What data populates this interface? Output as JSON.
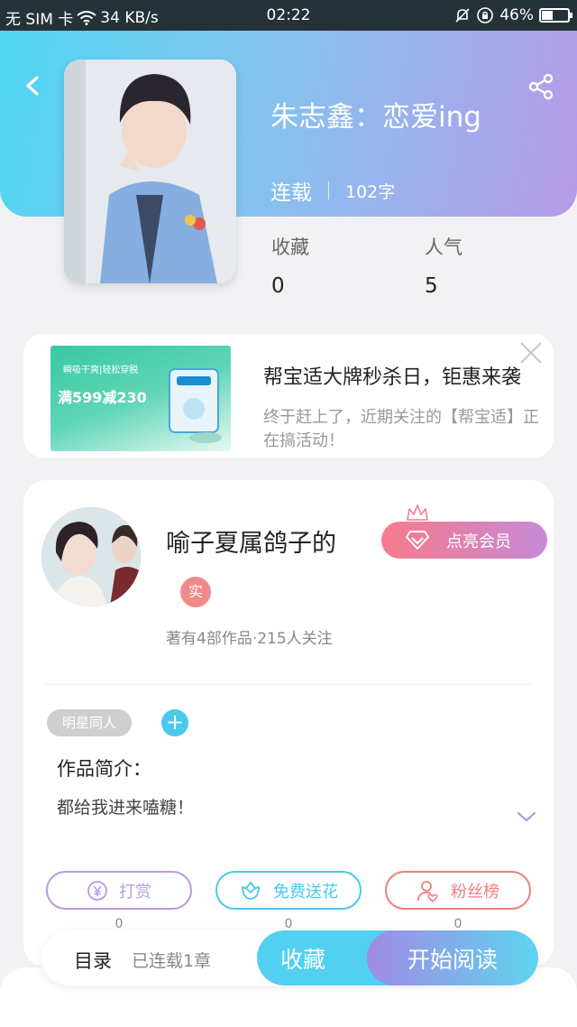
{
  "status_bar": {
    "carrier": "无 SIM 卡",
    "speed": "34 KB/s",
    "time": "02:22",
    "battery": "46%",
    "battery_level": 0.46,
    "icons": [
      "wifi-icon",
      "mute-icon",
      "rotation-lock-icon",
      "battery-icon"
    ]
  },
  "header": {
    "book_title": "朱志鑫：恋爱ing",
    "status": "连载",
    "word_count": "102字",
    "gradient": [
      "#4fd6f2",
      "#b69bea"
    ]
  },
  "stats": {
    "favorites_label": "收藏",
    "favorites_value": "0",
    "popularity_label": "人气",
    "popularity_value": "5"
  },
  "ad": {
    "image_text": "满599减230",
    "image_subtext": "瞬吸干爽|轻松穿脱",
    "title": "帮宝适大牌秒杀日，钜惠来袭",
    "description": "终于赶上了，近期关注的【帮宝适】正在搞活动！"
  },
  "author": {
    "name": "喻子夏属鸽子的",
    "badge": "实",
    "meta": "著有4部作品·215人关注",
    "vip_label": "点亮会员"
  },
  "tags": {
    "chip": "明星同人",
    "add": "+"
  },
  "intro": {
    "label": "作品简介：",
    "text": "都给我进来嗑糖！"
  },
  "actions": [
    {
      "label": "打赏",
      "count": "0",
      "icon": "yuan-coin-icon",
      "color": "#b79be6"
    },
    {
      "label": "免费送花",
      "count": "0",
      "icon": "flower-icon",
      "color": "#48c9ec"
    },
    {
      "label": "粉丝榜",
      "count": "0",
      "icon": "fan-user-icon",
      "color": "#f07f7f"
    }
  ],
  "bottom": {
    "toc": "目录",
    "chapters": "已连载1章",
    "favorite": "收藏",
    "read": "开始阅读"
  },
  "colors": {
    "accent_blue": "#52d0f1",
    "accent_purple": "#a08be5",
    "vip_pink": "#f77a8c"
  }
}
